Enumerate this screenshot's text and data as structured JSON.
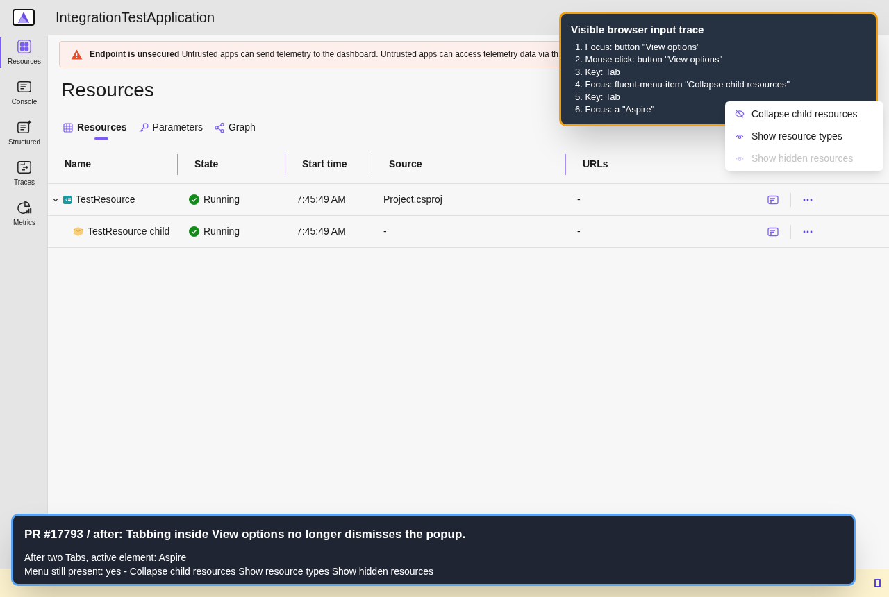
{
  "app": {
    "title": "IntegrationTestApplication"
  },
  "sidebar": {
    "items": [
      {
        "label": "Resources",
        "kind": "grid",
        "selected": true
      },
      {
        "label": "Console",
        "kind": "console",
        "selected": false
      },
      {
        "label": "Structured",
        "kind": "structured",
        "selected": false
      },
      {
        "label": "Traces",
        "kind": "traces",
        "selected": false
      },
      {
        "label": "Metrics",
        "kind": "metrics",
        "selected": false
      }
    ]
  },
  "banner": {
    "title": "Endpoint is unsecured",
    "message": "Untrusted apps can send telemetry to the dashboard. Untrusted apps can access telemetry data via th"
  },
  "page_title": "Resources",
  "tabs": [
    {
      "label": "Resources",
      "kind": "grid",
      "selected": true
    },
    {
      "label": "Parameters",
      "kind": "key",
      "selected": false
    },
    {
      "label": "Graph",
      "kind": "graph",
      "selected": false
    }
  ],
  "table": {
    "columns": [
      "Name",
      "State",
      "Start time",
      "Source",
      "URLs"
    ],
    "rows": [
      {
        "name": "TestResource",
        "kind": "project",
        "expanded": true,
        "state": "Running",
        "start_time": "7:45:49 AM",
        "source": "Project.csproj",
        "urls": "-",
        "children": [
          {
            "name": "TestResource child",
            "kind": "container",
            "state": "Running",
            "start_time": "7:45:49 AM",
            "source": "-",
            "urls": "-"
          }
        ]
      }
    ]
  },
  "view_menu": {
    "items": [
      {
        "label": "Collapse child resources",
        "kind": "eye-off",
        "disabled": false
      },
      {
        "label": "Show resource types",
        "kind": "eye",
        "disabled": false
      },
      {
        "label": "Show hidden resources",
        "kind": "eye",
        "disabled": true
      }
    ]
  },
  "trace": {
    "title": "Visible browser input trace",
    "steps": [
      "1. Focus: button \"View options\"",
      "2. Mouse click: button \"View options\"",
      "3. Key: Tab",
      "4. Focus: fluent-menu-item \"Collapse child resources\"",
      "5. Key: Tab",
      "6. Focus: a \"Aspire\""
    ]
  },
  "pr_note": {
    "title": "PR #17793 / after: Tabbing inside View options no longer dismisses the popup.",
    "lines": [
      "After two Tabs, active element: Aspire",
      "Menu still present: yes - Collapse child resources Show resource types Show hidden resources"
    ]
  }
}
